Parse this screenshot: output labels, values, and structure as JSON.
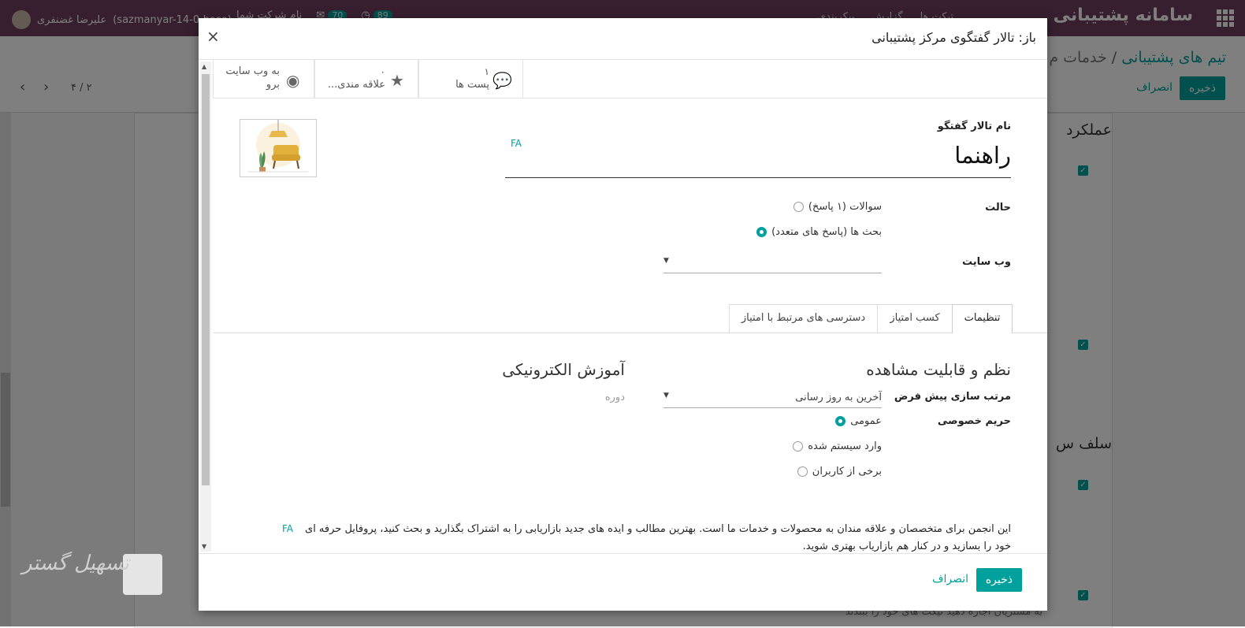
{
  "topbar": {
    "brand": "سامانه پشتیبانی",
    "menu": [
      "تیکت ها",
      "گزارش",
      "پیکربندی"
    ],
    "user_name": "علیرضا غضنفری",
    "db_name": "(sazmanyar-14-0-base)",
    "badge_activities": "89",
    "badge_messages": "70",
    "company": "نام شرکت شما"
  },
  "background": {
    "breadcrumb_root": "تیم های پشتیبانی",
    "breadcrumb_current": "خدمات م",
    "save_label": "ذخیره",
    "discard_label": "انصراف",
    "pager": "۴ / ۲",
    "section1": "عملکرد",
    "section2": "سلف س",
    "footer_text": "به مشتریان اجازه دهید تیکت های خود را ببندند"
  },
  "modal": {
    "title": "باز: تالار گفتگوی مرکز پشتیبانی",
    "close": "×",
    "stat_posts_count": "۱",
    "stat_posts_label": "پست ها",
    "stat_fav_count": "۰",
    "stat_fav_label": "علاقه مندی...",
    "stat_web_label1": "به وب سایت",
    "stat_web_label2": "برو",
    "forum_name_label": "نام تالار گفتگو",
    "forum_name": "راهنما",
    "lang": "FA",
    "mode_label": "حالت",
    "mode_questions": "سوالات (۱ پاسخ)",
    "mode_discussions": "بحث ها (پاسخ های متعدد)",
    "website_label": "وب سایت",
    "tabs": [
      "تنظیمات",
      "کسب امتیاز",
      "دسترسی های مرتبط با امتیاز"
    ],
    "section_order": "نظم و قابلیت مشاهده",
    "section_elearning": "آموزش الکترونیکی",
    "default_sort_label": "مرتب سازی پیش فرض",
    "default_sort_value": "آخرین به روز رسانی",
    "course_placeholder": "دوره",
    "privacy_label": "حریم خصوصی",
    "privacy_public": "عمومی",
    "privacy_signed": "وارد سیستم شده",
    "privacy_some": "برخی از کاربران",
    "description": "این انجمن برای متخصصان و علاقه مندان به محصولات و خدمات ما است. بهترین مطالب و ایده های جدید بازاریابی را به اشتراک بگذارید و بحث کنید، پروفایل حرفه ای خود را بسازید و در کنار هم بازاریاب بهتری شوید.",
    "save_label": "ذخیره",
    "discard_label": "انصراف"
  },
  "watermark": "تسهیل گستر",
  "colors": {
    "primary": "#00a09d",
    "topbar": "#6f3f5f"
  }
}
